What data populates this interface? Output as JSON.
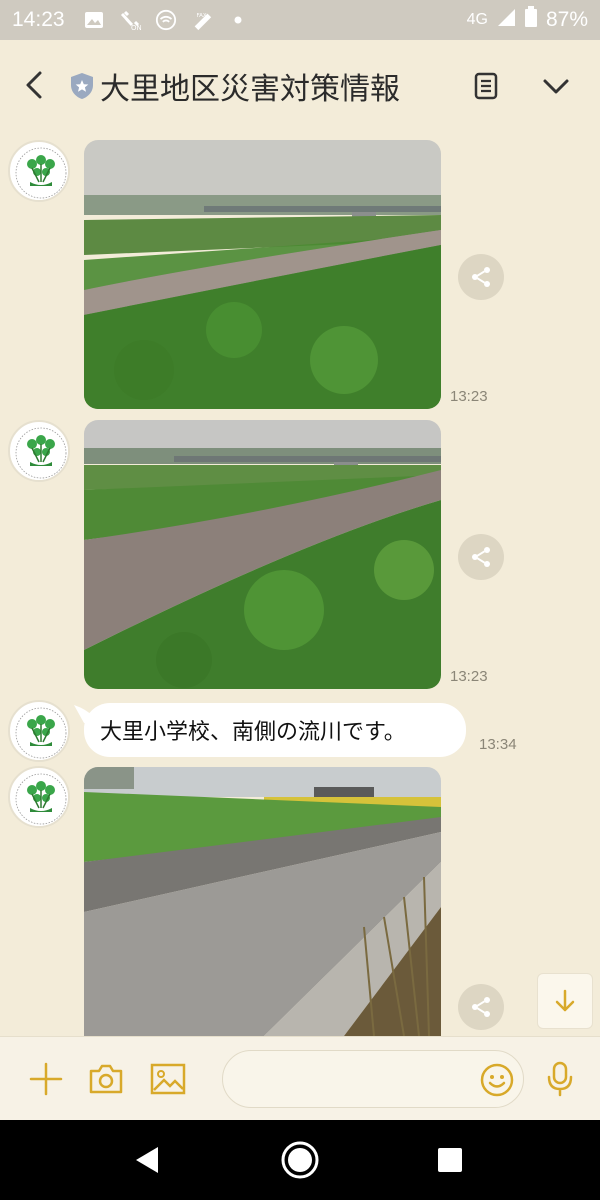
{
  "status_bar": {
    "time": "14:23",
    "network": "4G",
    "battery": "87%",
    "icons": [
      "gallery-icon",
      "volte-icon",
      "wifi-call-icon",
      "fax-icon",
      "dot-icon"
    ]
  },
  "header": {
    "title": "大里地区災害対策情報",
    "icons": [
      "back-icon",
      "official-shield-icon",
      "note-icon",
      "chevron-down-icon"
    ]
  },
  "messages": [
    {
      "type": "image",
      "time": "13:23",
      "subject": "river-with-bridge-1"
    },
    {
      "type": "image",
      "time": "13:23",
      "subject": "river-with-bridge-2"
    },
    {
      "type": "text",
      "text": "大里小学校、南側の流川です。",
      "time": "13:34"
    },
    {
      "type": "image",
      "time": "",
      "subject": "canal"
    }
  ],
  "input_bar": {
    "placeholder": "",
    "icons": [
      "plus-icon",
      "camera-icon",
      "image-icon",
      "emoji-icon",
      "mic-icon"
    ]
  },
  "nav_bar": {
    "icons": [
      "back-triangle-icon",
      "home-circle-icon",
      "recents-square-icon"
    ]
  },
  "colors": {
    "background": "#f3ecd9",
    "accent": "#d8a92a",
    "status_bar": "#cfcac0"
  }
}
